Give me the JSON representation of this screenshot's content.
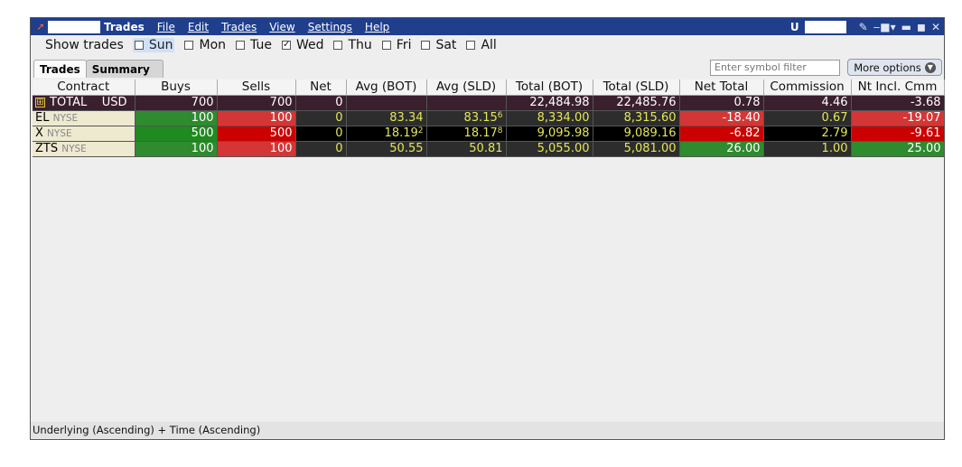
{
  "window": {
    "title": "Trades",
    "menu": [
      "File",
      "Edit",
      "Trades",
      "View",
      "Settings",
      "Help"
    ],
    "icons": [
      "wrench-icon",
      "pin-icon",
      "minimize-icon",
      "maximize-icon",
      "close-icon"
    ]
  },
  "show_trades": {
    "label": "Show trades",
    "days": [
      {
        "label": "Sun",
        "checked": false
      },
      {
        "label": "Mon",
        "checked": false
      },
      {
        "label": "Tue",
        "checked": false
      },
      {
        "label": "Wed",
        "checked": true
      },
      {
        "label": "Thu",
        "checked": false
      },
      {
        "label": "Fri",
        "checked": false
      },
      {
        "label": "Sat",
        "checked": false
      },
      {
        "label": "All",
        "checked": false
      }
    ]
  },
  "tabs": [
    {
      "label": "Trades",
      "active": true
    },
    {
      "label": "Summary",
      "active": false
    }
  ],
  "filter": {
    "placeholder": "Enter symbol filter"
  },
  "more_options": {
    "label": "More options"
  },
  "table": {
    "columns": [
      "Contract",
      "Buys",
      "Sells",
      "Net",
      "Avg (BOT)",
      "Avg (SLD)",
      "Total (BOT)",
      "Total (SLD)",
      "Net Total",
      "Commission",
      "Nt Incl. Cmm"
    ],
    "total_row": {
      "expand": "⊞",
      "label": "TOTAL",
      "currency": "USD",
      "buys": "700",
      "sells": "700",
      "net": "0",
      "avg_bot": "",
      "avg_sld": "",
      "total_bot": "22,484.98",
      "total_sld": "22,485.76",
      "net_total": "0.78",
      "commission": "4.46",
      "nt_incl_cmm": "-3.68"
    },
    "rows": [
      {
        "symbol": "EL",
        "exchange": "NYSE",
        "buys": "100",
        "sells": "100",
        "net": "0",
        "avg_bot": "83.34",
        "avg_bot_sup": "",
        "avg_sld": "83.15",
        "avg_sld_sup": "6",
        "total_bot": "8,334.00",
        "total_sld": "8,315.60",
        "net_total": "-18.40",
        "commission": "0.67",
        "nt_incl_cmm": "-19.07"
      },
      {
        "symbol": "X",
        "exchange": "NYSE",
        "buys": "500",
        "sells": "500",
        "net": "0",
        "avg_bot": "18.19",
        "avg_bot_sup": "2",
        "avg_sld": "18.17",
        "avg_sld_sup": "8",
        "total_bot": "9,095.98",
        "total_sld": "9,089.16",
        "net_total": "-6.82",
        "commission": "2.79",
        "nt_incl_cmm": "-9.61"
      },
      {
        "symbol": "ZTS",
        "exchange": "NYSE",
        "buys": "100",
        "sells": "100",
        "net": "0",
        "avg_bot": "50.55",
        "avg_bot_sup": "",
        "avg_sld": "50.81",
        "avg_sld_sup": "",
        "total_bot": "5,055.00",
        "total_sld": "5,081.00",
        "net_total": "26.00",
        "commission": "1.00",
        "nt_incl_cmm": "25.00"
      }
    ]
  },
  "status_bar": {
    "text": "Underlying (Ascending)  +  Time (Ascending)"
  },
  "colors": {
    "titlebar": "#1f3e8c",
    "buy": "#2e8b2e",
    "sell": "#d43636",
    "value_text": "#e6e65a"
  }
}
